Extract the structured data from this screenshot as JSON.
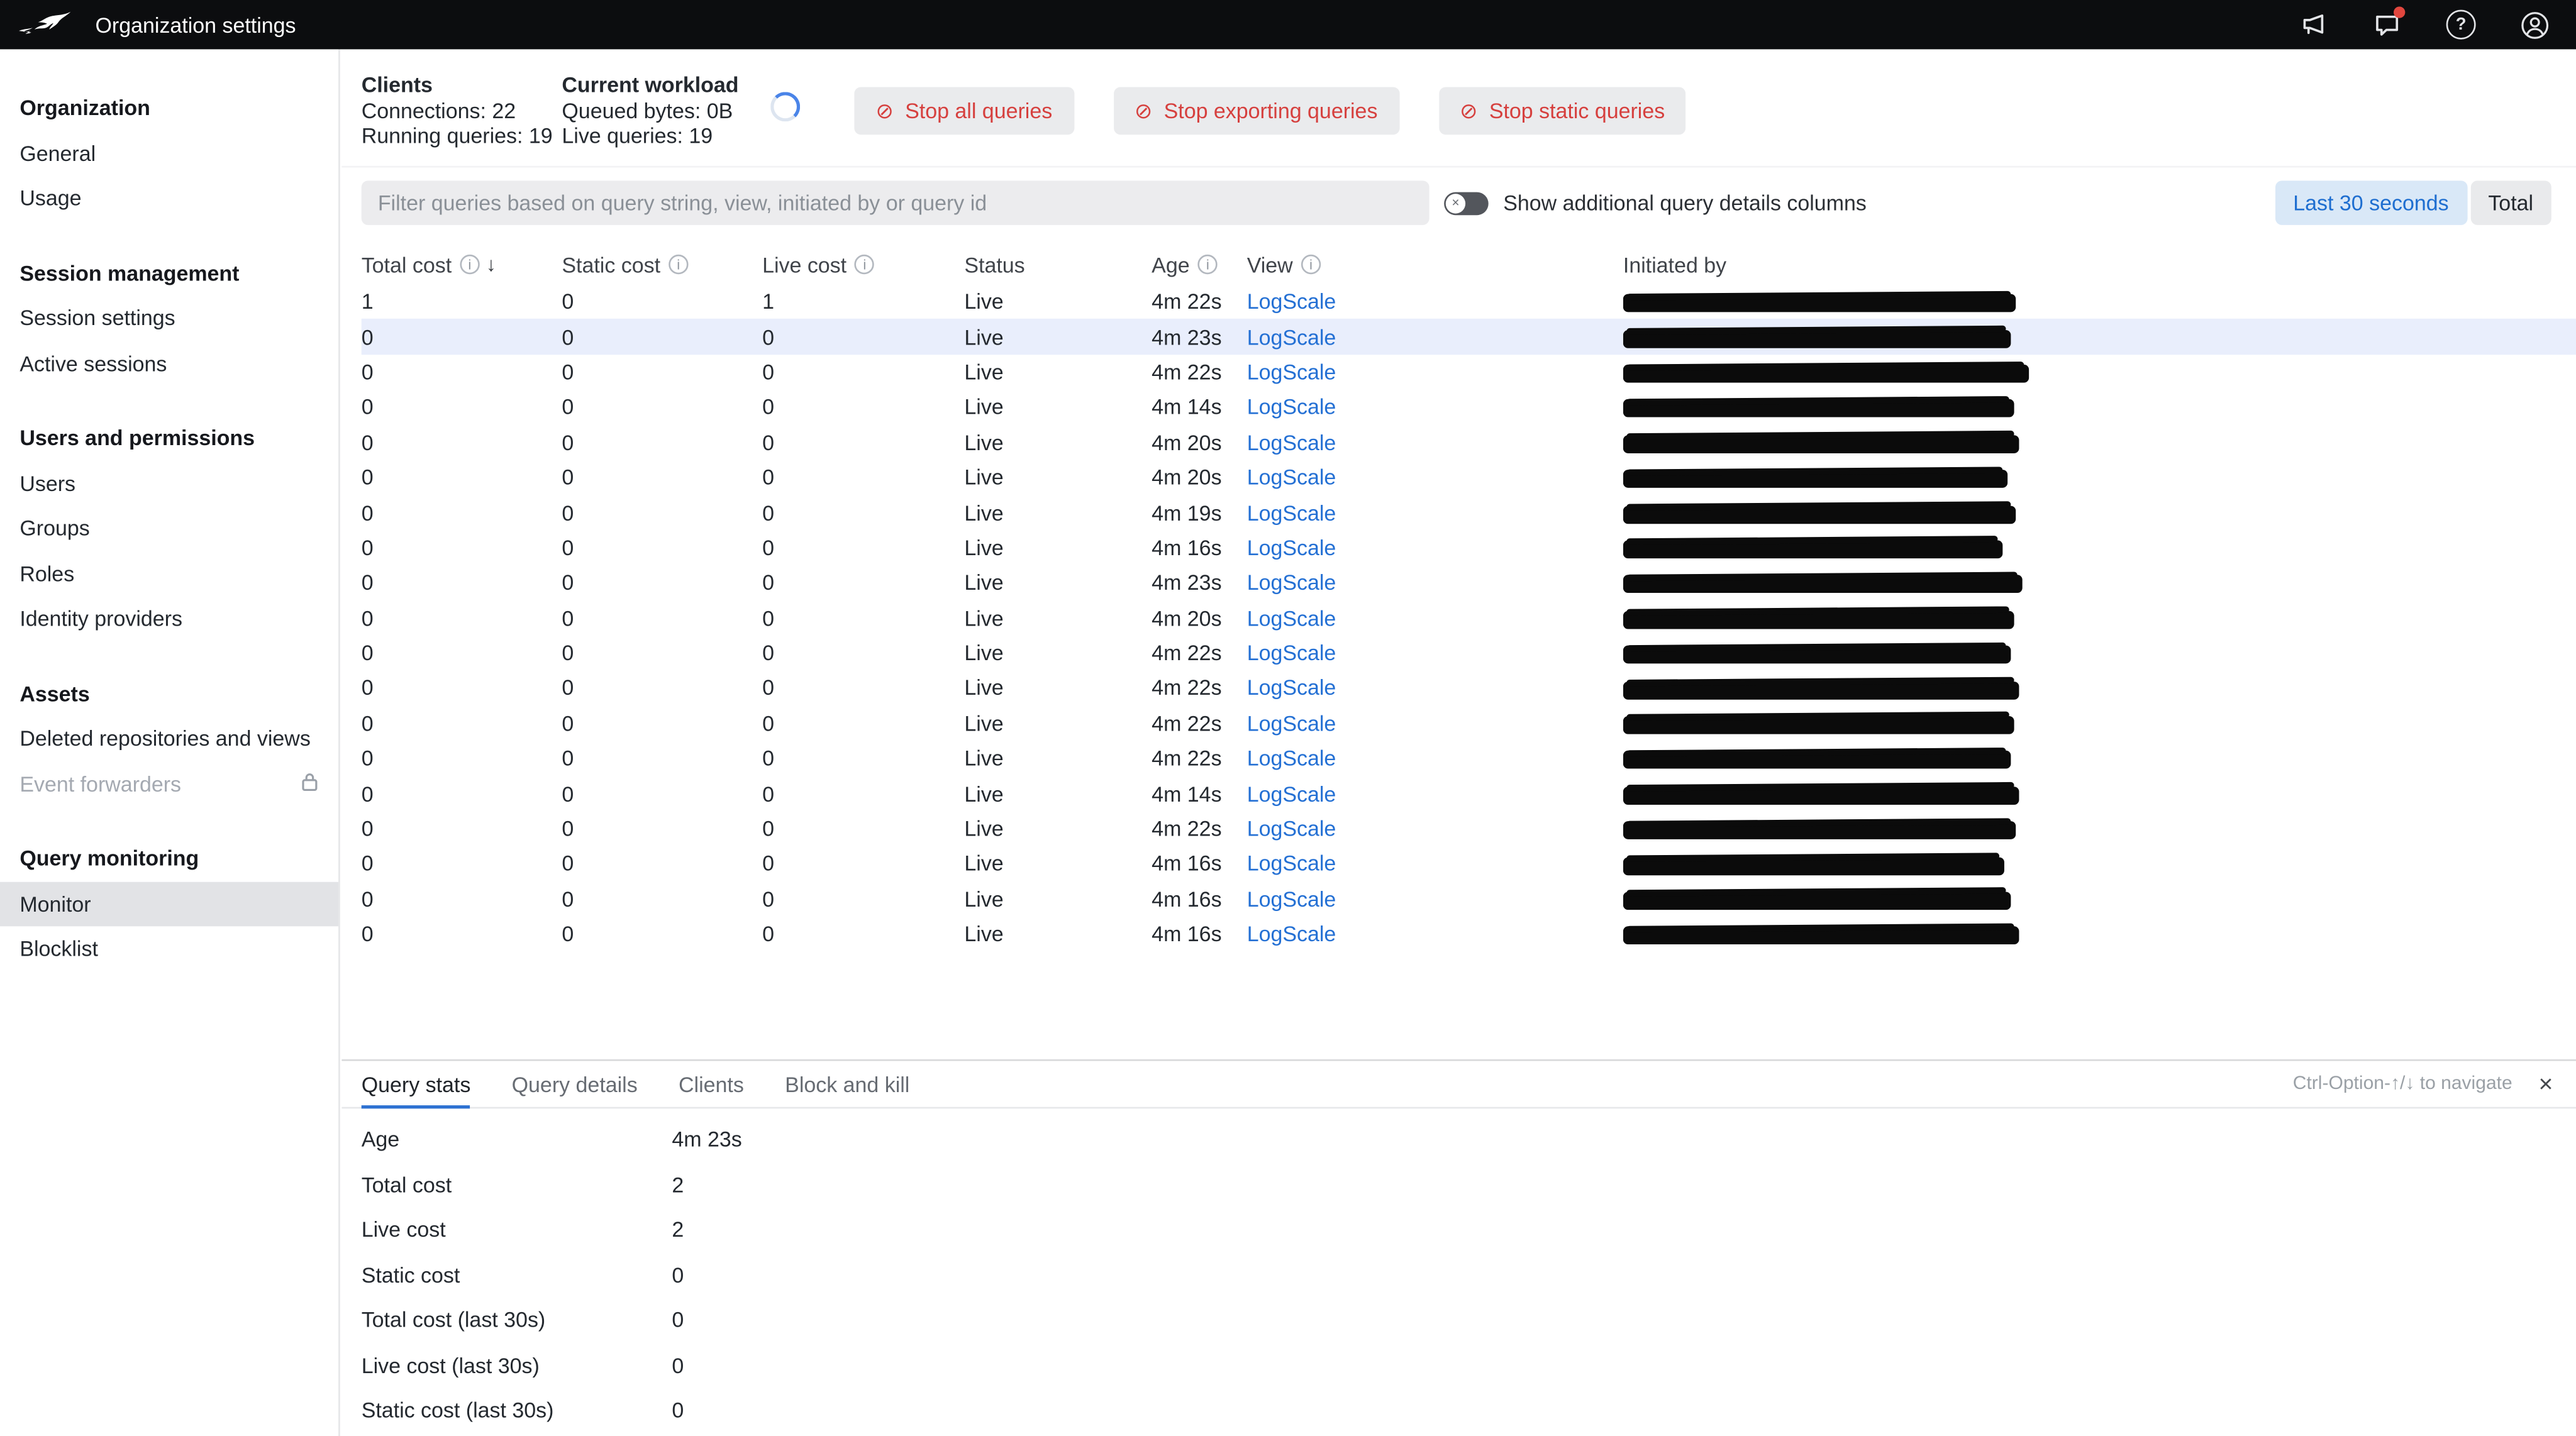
{
  "topbar": {
    "title": "Organization settings"
  },
  "sidebar": {
    "sections": [
      {
        "header": "Organization",
        "items": [
          {
            "label": "General"
          },
          {
            "label": "Usage"
          }
        ]
      },
      {
        "header": "Session management",
        "items": [
          {
            "label": "Session settings"
          },
          {
            "label": "Active sessions"
          }
        ]
      },
      {
        "header": "Users and permissions",
        "items": [
          {
            "label": "Users"
          },
          {
            "label": "Groups"
          },
          {
            "label": "Roles"
          },
          {
            "label": "Identity providers"
          }
        ]
      },
      {
        "header": "Assets",
        "items": [
          {
            "label": "Deleted repositories and views"
          },
          {
            "label": "Event forwarders",
            "disabled": true,
            "locked": true
          }
        ]
      },
      {
        "header": "Query monitoring",
        "items": [
          {
            "label": "Monitor",
            "selected": true
          },
          {
            "label": "Blocklist"
          }
        ]
      }
    ]
  },
  "workload": {
    "clients": {
      "title": "Clients",
      "line1": "Connections: 22",
      "line2": "Running queries: 19"
    },
    "current": {
      "title": "Current workload",
      "line1": "Queued bytes: 0B",
      "line2": "Live queries: 19"
    },
    "buttons": [
      {
        "label": "Stop all queries"
      },
      {
        "label": "Stop exporting queries"
      },
      {
        "label": "Stop static queries"
      }
    ]
  },
  "controls": {
    "filter_placeholder": "Filter queries based on query string, view, initiated by or query id",
    "toggle_label": "Show additional query details columns",
    "range": [
      {
        "label": "Last 30 seconds",
        "active": true
      },
      {
        "label": "Total",
        "active": false
      }
    ]
  },
  "table": {
    "columns": [
      {
        "label": "Total cost",
        "info": true,
        "sort": "desc"
      },
      {
        "label": "Static cost",
        "info": true
      },
      {
        "label": "Live cost",
        "info": true
      },
      {
        "label": "Status"
      },
      {
        "label": "Age",
        "info": true
      },
      {
        "label": "View",
        "info": true
      },
      {
        "label": "Initiated by"
      }
    ],
    "rows": [
      {
        "total": "1",
        "static": "0",
        "live": "1",
        "status": "Live",
        "age": "4m 22s",
        "view": "LogScale",
        "initiated": "[redacted]"
      },
      {
        "total": "0",
        "static": "0",
        "live": "0",
        "status": "Live",
        "age": "4m 23s",
        "view": "LogScale",
        "initiated": "[redacted]",
        "selected": true
      },
      {
        "total": "0",
        "static": "0",
        "live": "0",
        "status": "Live",
        "age": "4m 22s",
        "view": "LogScale",
        "initiated": "[redacted]"
      },
      {
        "total": "0",
        "static": "0",
        "live": "0",
        "status": "Live",
        "age": "4m 14s",
        "view": "LogScale",
        "initiated": "[redacted]"
      },
      {
        "total": "0",
        "static": "0",
        "live": "0",
        "status": "Live",
        "age": "4m 20s",
        "view": "LogScale",
        "initiated": "[redacted]"
      },
      {
        "total": "0",
        "static": "0",
        "live": "0",
        "status": "Live",
        "age": "4m 20s",
        "view": "LogScale",
        "initiated": "[redacted]"
      },
      {
        "total": "0",
        "static": "0",
        "live": "0",
        "status": "Live",
        "age": "4m 19s",
        "view": "LogScale",
        "initiated": "[redacted]"
      },
      {
        "total": "0",
        "static": "0",
        "live": "0",
        "status": "Live",
        "age": "4m 16s",
        "view": "LogScale",
        "initiated": "[redacted]"
      },
      {
        "total": "0",
        "static": "0",
        "live": "0",
        "status": "Live",
        "age": "4m 23s",
        "view": "LogScale",
        "initiated": "[redacted]"
      },
      {
        "total": "0",
        "static": "0",
        "live": "0",
        "status": "Live",
        "age": "4m 20s",
        "view": "LogScale",
        "initiated": "[redacted]"
      },
      {
        "total": "0",
        "static": "0",
        "live": "0",
        "status": "Live",
        "age": "4m 22s",
        "view": "LogScale",
        "initiated": "[redacted]"
      },
      {
        "total": "0",
        "static": "0",
        "live": "0",
        "status": "Live",
        "age": "4m 22s",
        "view": "LogScale",
        "initiated": "[redacted]"
      },
      {
        "total": "0",
        "static": "0",
        "live": "0",
        "status": "Live",
        "age": "4m 22s",
        "view": "LogScale",
        "initiated": "[redacted]"
      },
      {
        "total": "0",
        "static": "0",
        "live": "0",
        "status": "Live",
        "age": "4m 22s",
        "view": "LogScale",
        "initiated": "[redacted]"
      },
      {
        "total": "0",
        "static": "0",
        "live": "0",
        "status": "Live",
        "age": "4m 14s",
        "view": "LogScale",
        "initiated": "[redacted]"
      },
      {
        "total": "0",
        "static": "0",
        "live": "0",
        "status": "Live",
        "age": "4m 22s",
        "view": "LogScale",
        "initiated": "[redacted]"
      },
      {
        "total": "0",
        "static": "0",
        "live": "0",
        "status": "Live",
        "age": "4m 16s",
        "view": "LogScale",
        "initiated": "[redacted]"
      },
      {
        "total": "0",
        "static": "0",
        "live": "0",
        "status": "Live",
        "age": "4m 16s",
        "view": "LogScale",
        "initiated": "[redacted]"
      },
      {
        "total": "0",
        "static": "0",
        "live": "0",
        "status": "Live",
        "age": "4m 16s",
        "view": "LogScale",
        "initiated": "[redacted]"
      }
    ]
  },
  "details": {
    "tabs": [
      {
        "label": "Query stats",
        "active": true
      },
      {
        "label": "Query details"
      },
      {
        "label": "Clients"
      },
      {
        "label": "Block and kill"
      }
    ],
    "shortcut_hint": "Ctrl-Option-↑/↓ to navigate",
    "stats": [
      {
        "label": "Age",
        "value": "4m 23s"
      },
      {
        "label": "Total cost",
        "value": "2"
      },
      {
        "label": "Live cost",
        "value": "2"
      },
      {
        "label": "Static cost",
        "value": "0"
      },
      {
        "label": "Total cost (last 30s)",
        "value": "0"
      },
      {
        "label": "Live cost (last 30s)",
        "value": "0"
      },
      {
        "label": "Static cost (last 30s)",
        "value": "0"
      }
    ]
  },
  "icons": {
    "info": "i",
    "sort_desc": "↓",
    "stop": "⊘",
    "close": "×",
    "help": "?",
    "toggle_off": "×"
  },
  "colors": {
    "accent_blue": "#2470d4",
    "danger_red": "#d6403e",
    "selected_row": "#e9eefc",
    "topbar_bg": "#0c0d0f"
  }
}
